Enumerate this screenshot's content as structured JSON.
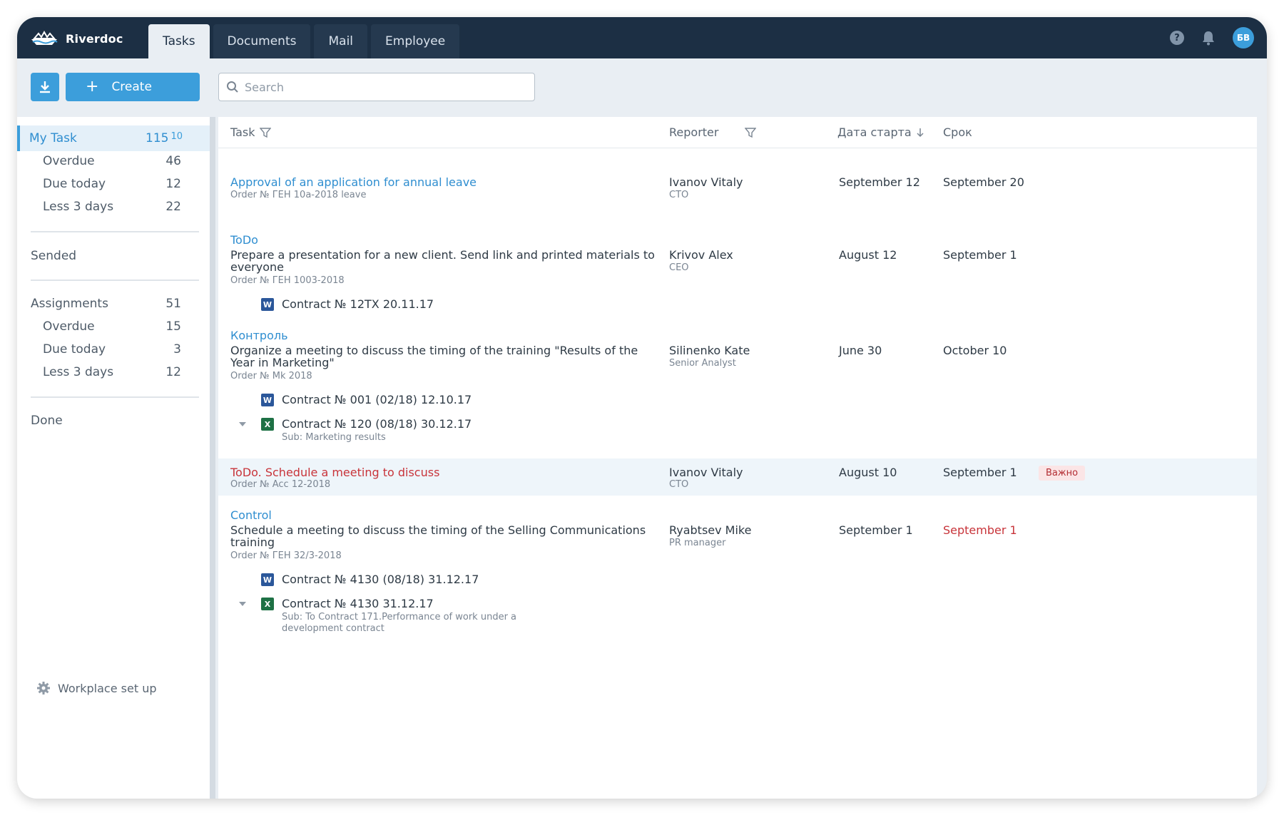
{
  "app": {
    "name": "Riverdoc",
    "user_initials": "БВ",
    "help_glyph": "?"
  },
  "tabs": [
    {
      "label": "Tasks",
      "active": true
    },
    {
      "label": "Documents",
      "active": false
    },
    {
      "label": "Mail",
      "active": false
    },
    {
      "label": "Employee",
      "active": false
    }
  ],
  "toolbar": {
    "create_label": "Create",
    "create_plus": "+",
    "search_placeholder": "Search"
  },
  "sidebar": {
    "my_task": {
      "label": "My Task",
      "count": "115",
      "sub_count": "10"
    },
    "my_task_items": [
      {
        "label": "Overdue",
        "count": "46"
      },
      {
        "label": "Due today",
        "count": "12"
      },
      {
        "label": "Less 3 days",
        "count": "22"
      }
    ],
    "sended": "Sended",
    "assignments": {
      "label": "Assignments",
      "count": "51"
    },
    "assignment_items": [
      {
        "label": "Overdue",
        "count": "15"
      },
      {
        "label": "Due today",
        "count": "3"
      },
      {
        "label": "Less 3 days",
        "count": "12"
      }
    ],
    "done": "Done",
    "setup": "Workplace set up"
  },
  "columns": {
    "task": "Task",
    "reporter": "Reporter",
    "start": "Дата старта",
    "deadline": "Срок"
  },
  "tasks": [
    {
      "title": "Approval of an application for annual leave",
      "order": "Order № ГЕН 10а-2018 leave",
      "reporter": "Ivanov Vitaly",
      "role": "CTO",
      "start": "September 12",
      "deadline": "September 20"
    },
    {
      "category": "ToDo",
      "desc1": "Prepare a presentation for a new client. Send link and printed materials to",
      "desc2": "everyone",
      "order": "Order № ГЕН 1003-2018",
      "reporter": "Krivov Alex",
      "role": "CEO",
      "start": "August 12",
      "deadline": "September 1",
      "files": [
        {
          "name": "Contract № 12ТХ 20.11.17",
          "type": "W"
        }
      ]
    },
    {
      "category": "Контроль",
      "desc1": "Organize a meeting to discuss the timing of the training \"Results of the",
      "desc2": "Year in Marketing\"",
      "order": "Order № Mk 2018",
      "reporter": "Silinenko Kate",
      "role": "Senior Analyst",
      "start": "June 30",
      "deadline": "October 10",
      "files": [
        {
          "name": "Contract № 001  (02/18)  12.10.17",
          "type": "W"
        },
        {
          "name": "Contract № 120  (08/18)  30.12.17",
          "type": "X",
          "sub": "Sub: Marketing results"
        }
      ]
    },
    {
      "title": "ToDo. Schedule a meeting to discuss",
      "order": "Order № Acc 12-2018",
      "reporter": "Ivanov Vitaly",
      "role": "CTO",
      "start": "August 10",
      "deadline": "September 1",
      "badge": "Важно"
    },
    {
      "category": "Control",
      "desc1": "Schedule a meeting to discuss the timing of the Selling Communications",
      "desc2": "training",
      "order": "Order № ГЕН 32/3-2018",
      "reporter": "Ryabtsev Mike",
      "role": "PR manager",
      "start": "September 1",
      "deadline": "September 1",
      "files": [
        {
          "name": "Contract № 4130  (08/18)  31.12.17",
          "type": "W"
        },
        {
          "name": "Contract № 4130  31.12.17",
          "type": "X",
          "sub1": "Sub: To Contract 171.Performance of work under a",
          "sub2": "development contract"
        }
      ]
    }
  ],
  "colors": {
    "accent": "#3c9edb",
    "navbar": "#1c2f44",
    "danger": "#c8343a"
  }
}
